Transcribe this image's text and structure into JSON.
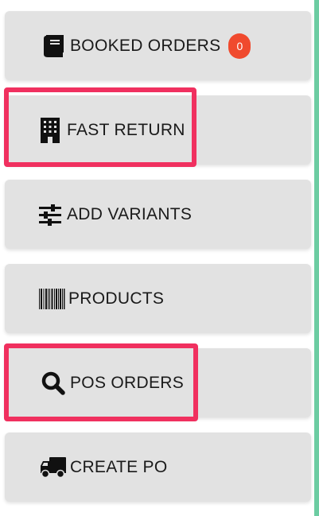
{
  "menu": {
    "items": [
      {
        "label": "BOOKED ORDERS",
        "icon": "book-icon",
        "badge": "0"
      },
      {
        "label": "FAST RETURN",
        "icon": "building-icon",
        "highlighted": true
      },
      {
        "label": "ADD VARIANTS",
        "icon": "sliders-icon"
      },
      {
        "label": "PRODUCTS",
        "icon": "barcode-icon"
      },
      {
        "label": "POS ORDERS",
        "icon": "search-icon",
        "highlighted": true
      },
      {
        "label": "CREATE PO",
        "icon": "truck-icon"
      }
    ]
  },
  "colors": {
    "item_background": "#e2e2e2",
    "highlight_border": "#f0305f",
    "badge_background": "#f04a2e",
    "accent_stripe": "#6ccca2"
  }
}
